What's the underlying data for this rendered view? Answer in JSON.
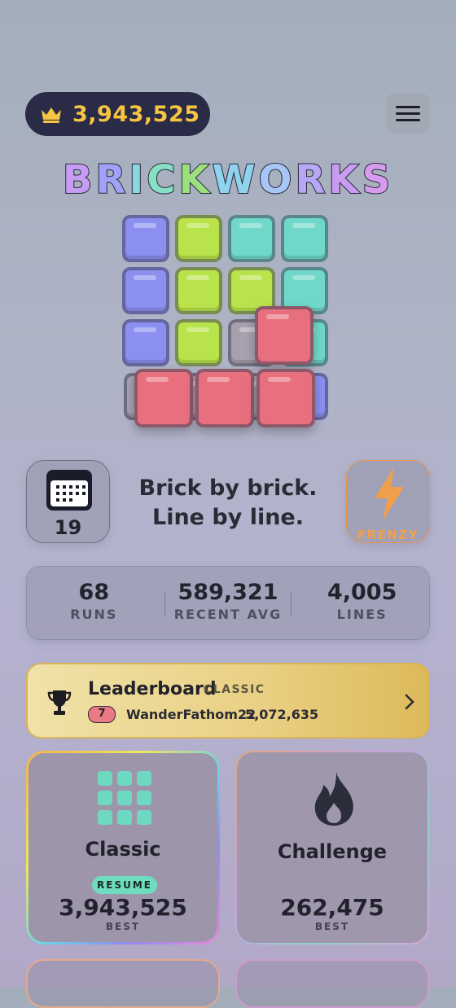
{
  "header": {
    "score": "3,943,525"
  },
  "title": {
    "letters": [
      "B",
      "R",
      "I",
      "C",
      "K",
      "W",
      "O",
      "R",
      "K",
      "S"
    ],
    "colors": [
      "#c69cf5",
      "#9fa2f8",
      "#8cd6e0",
      "#85e0c4",
      "#9be07c",
      "#8fd3ee",
      "#a7c6f6",
      "#b7a7f6",
      "#c99cf2",
      "#d79cf0"
    ]
  },
  "daily": {
    "day": "19"
  },
  "tagline": {
    "line1": "Brick by brick.",
    "line2": "Line by line."
  },
  "frenzy": {
    "label": "FRENZY"
  },
  "stats": [
    {
      "value": "68",
      "label": "RUNS"
    },
    {
      "value": "589,321",
      "label": "RECENT AVG"
    },
    {
      "value": "4,005",
      "label": "LINES"
    }
  ],
  "leaderboard": {
    "title": "Leaderboard",
    "mode": "CLASSIC",
    "rank": "7",
    "player": "WanderFathom22",
    "score": "5,072,635"
  },
  "modes": [
    {
      "name": "Classic",
      "badge": "RESUME",
      "best": "3,943,525",
      "best_label": "BEST"
    },
    {
      "name": "Challenge",
      "best": "262,475",
      "best_label": "BEST"
    }
  ],
  "colors": {
    "purple": "#8b8ff0",
    "lime": "#b9e34a",
    "teal": "#6fd8c8",
    "red": "#e8707e",
    "gold": "#f5c542",
    "orange": "#f0a04a"
  }
}
